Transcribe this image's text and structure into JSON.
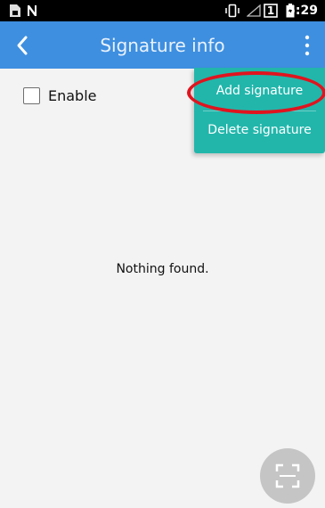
{
  "status_bar": {
    "time": "5:29",
    "sim_badge": "1",
    "icons": [
      "sim-card-icon",
      "n-notification-icon",
      "vibrate-icon",
      "signal-icon",
      "sim-slot-icon",
      "battery-icon"
    ]
  },
  "app_bar": {
    "title": "Signature info",
    "back_icon": "chevron-left-icon",
    "overflow_icon": "more-vert-icon",
    "color": "#3e8fe0"
  },
  "enable": {
    "label": "Enable",
    "checked": false
  },
  "menu": {
    "items": [
      {
        "label": "Add signature"
      },
      {
        "label": "Delete signature"
      }
    ],
    "color": "#22b6ab",
    "highlight_color": "#e0141e"
  },
  "empty_state": {
    "text": "Nothing found."
  },
  "fab": {
    "icon": "scan-frame-icon"
  }
}
